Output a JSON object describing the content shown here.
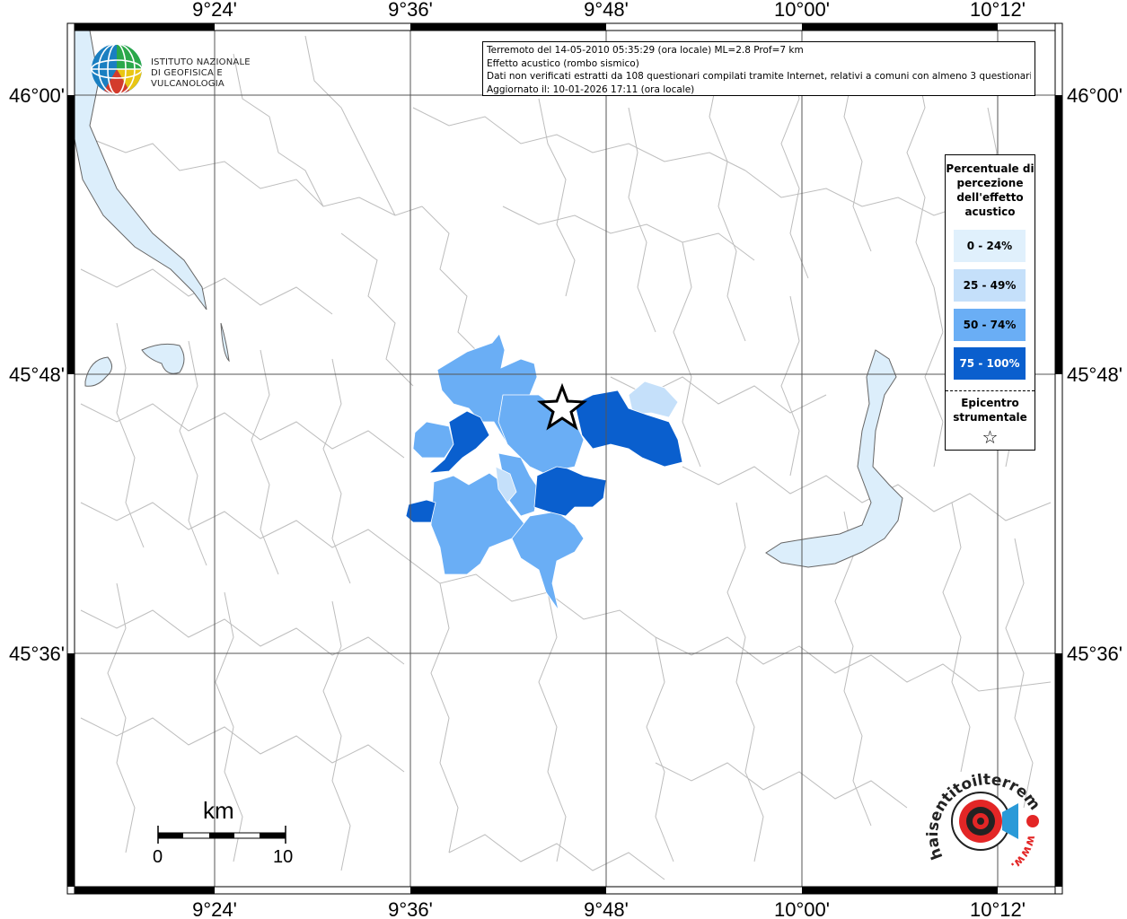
{
  "header": {
    "line1": "Terremoto del 14-05-2010 05:35:29 (ora locale) ML=2.8 Prof=7 km",
    "line2": "Effetto acustico (rombo sismico)",
    "line3": "Dati non verificati estratti da 108 questionari compilati tramite Internet, relativi a comuni con almeno 3 questionari.",
    "line4": "Aggiornato il: 10-01-2026 17:11 (ora locale)"
  },
  "logo": {
    "line1": "ISTITUTO NAZIONALE",
    "line2": "DI GEOFISICA E VULCANOLOGIA"
  },
  "axes": {
    "top": [
      "9°24'",
      "9°36'",
      "9°48'",
      "10°00'",
      "10°12'"
    ],
    "bottom": [
      "9°24'",
      "9°36'",
      "9°48'",
      "10°00'",
      "10°12'"
    ],
    "left": [
      "46°00'",
      "45°48'",
      "45°36'"
    ],
    "right": [
      "46°00'",
      "45°48'",
      "45°36'"
    ]
  },
  "legend": {
    "title": "Percentuale di percezione dell'effetto acustico",
    "classes": [
      {
        "label": "0 - 24%",
        "color": "#e0f0fc"
      },
      {
        "label": "25 - 49%",
        "color": "#c5e0fa"
      },
      {
        "label": "50 - 74%",
        "color": "#6aaef5"
      },
      {
        "label": "75 - 100%",
        "color": "#0a5fce"
      }
    ],
    "epicenter_label": "Epicentro strumentale",
    "epicenter_icon": "star-icon"
  },
  "scale": {
    "unit": "km",
    "min_label": "0",
    "max_label": "10"
  },
  "brand": {
    "text": "haisentitoilterremoto.it",
    "url_text": "www."
  },
  "colors": {
    "lake": "#dceefb",
    "border": "#b0b0b0",
    "class_0_24": "#e0f0fc",
    "class_25_49": "#c5e0fa",
    "class_50_74": "#6aaef5",
    "class_75_100": "#0a5fce"
  }
}
